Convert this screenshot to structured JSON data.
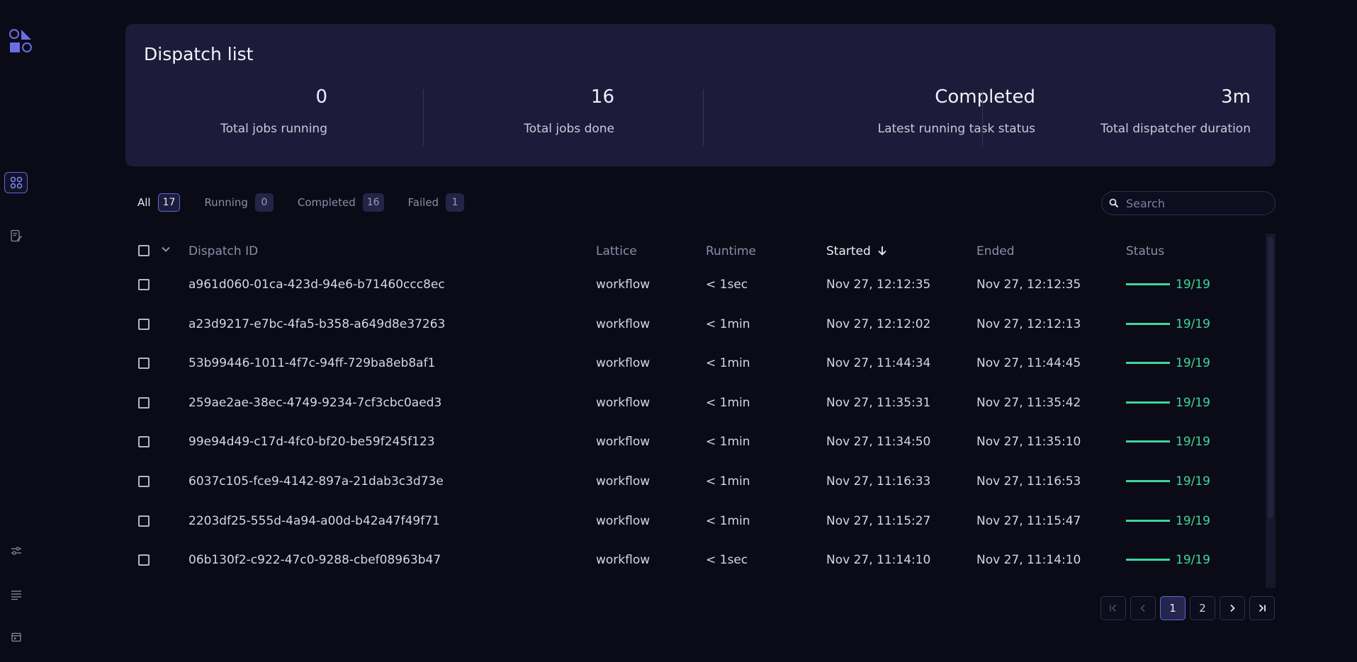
{
  "sidebar": {
    "logo": "covalent-logo",
    "nav": [
      {
        "icon": "dispatch-list-icon",
        "active": true
      },
      {
        "icon": "lattice-editor-icon",
        "active": false
      }
    ],
    "bottom": [
      {
        "icon": "settings-sliders-icon"
      },
      {
        "icon": "logs-icon"
      },
      {
        "icon": "calendar-icon"
      }
    ]
  },
  "summary": {
    "title": "Dispatch list",
    "stats": [
      {
        "value": "0",
        "label": "Total jobs running"
      },
      {
        "value": "16",
        "label": "Total jobs done"
      },
      {
        "value": "Completed",
        "label": "Latest running task status"
      },
      {
        "value": "3m",
        "label": "Total dispatcher duration"
      }
    ]
  },
  "filters": [
    {
      "label": "All",
      "count": "17",
      "active": true
    },
    {
      "label": "Running",
      "count": "0",
      "active": false
    },
    {
      "label": "Completed",
      "count": "16",
      "active": false
    },
    {
      "label": "Failed",
      "count": "1",
      "active": false
    }
  ],
  "search": {
    "placeholder": "Search"
  },
  "table": {
    "headers": {
      "dispatch_id": "Dispatch ID",
      "lattice": "Lattice",
      "runtime": "Runtime",
      "started": "Started",
      "ended": "Ended",
      "status": "Status"
    },
    "sort": {
      "column": "started",
      "direction": "desc"
    },
    "rows": [
      {
        "id": "a961d060-01ca-423d-94e6-b71460ccc8ec",
        "lattice": "workflow",
        "runtime": "< 1sec",
        "started": "Nov 27, 12:12:35",
        "ended": "Nov 27, 12:12:35",
        "status": "19/19",
        "progress": 1.0
      },
      {
        "id": "a23d9217-e7bc-4fa5-b358-a649d8e37263",
        "lattice": "workflow",
        "runtime": "< 1min",
        "started": "Nov 27, 12:12:02",
        "ended": "Nov 27, 12:12:13",
        "status": "19/19",
        "progress": 1.0
      },
      {
        "id": "53b99446-1011-4f7c-94ff-729ba8eb8af1",
        "lattice": "workflow",
        "runtime": "< 1min",
        "started": "Nov 27, 11:44:34",
        "ended": "Nov 27, 11:44:45",
        "status": "19/19",
        "progress": 1.0
      },
      {
        "id": "259ae2ae-38ec-4749-9234-7cf3cbc0aed3",
        "lattice": "workflow",
        "runtime": "< 1min",
        "started": "Nov 27, 11:35:31",
        "ended": "Nov 27, 11:35:42",
        "status": "19/19",
        "progress": 1.0
      },
      {
        "id": "99e94d49-c17d-4fc0-bf20-be59f245f123",
        "lattice": "workflow",
        "runtime": "< 1min",
        "started": "Nov 27, 11:34:50",
        "ended": "Nov 27, 11:35:10",
        "status": "19/19",
        "progress": 1.0
      },
      {
        "id": "6037c105-fce9-4142-897a-21dab3c3d73e",
        "lattice": "workflow",
        "runtime": "< 1min",
        "started": "Nov 27, 11:16:33",
        "ended": "Nov 27, 11:16:53",
        "status": "19/19",
        "progress": 1.0
      },
      {
        "id": "2203df25-555d-4a94-a00d-b42a47f49f71",
        "lattice": "workflow",
        "runtime": "< 1min",
        "started": "Nov 27, 11:15:27",
        "ended": "Nov 27, 11:15:47",
        "status": "19/19",
        "progress": 1.0
      },
      {
        "id": "06b130f2-c922-47c0-9288-cbef08963b47",
        "lattice": "workflow",
        "runtime": "< 1sec",
        "started": "Nov 27, 11:14:10",
        "ended": "Nov 27, 11:14:10",
        "status": "19/19",
        "progress": 1.0
      }
    ]
  },
  "pagination": {
    "pages": [
      "1",
      "2"
    ],
    "current": "1"
  },
  "colors": {
    "accent": "#6366d8",
    "success": "#3fd69a",
    "panel": "#1c1c3a",
    "background": "#0a0b17"
  }
}
